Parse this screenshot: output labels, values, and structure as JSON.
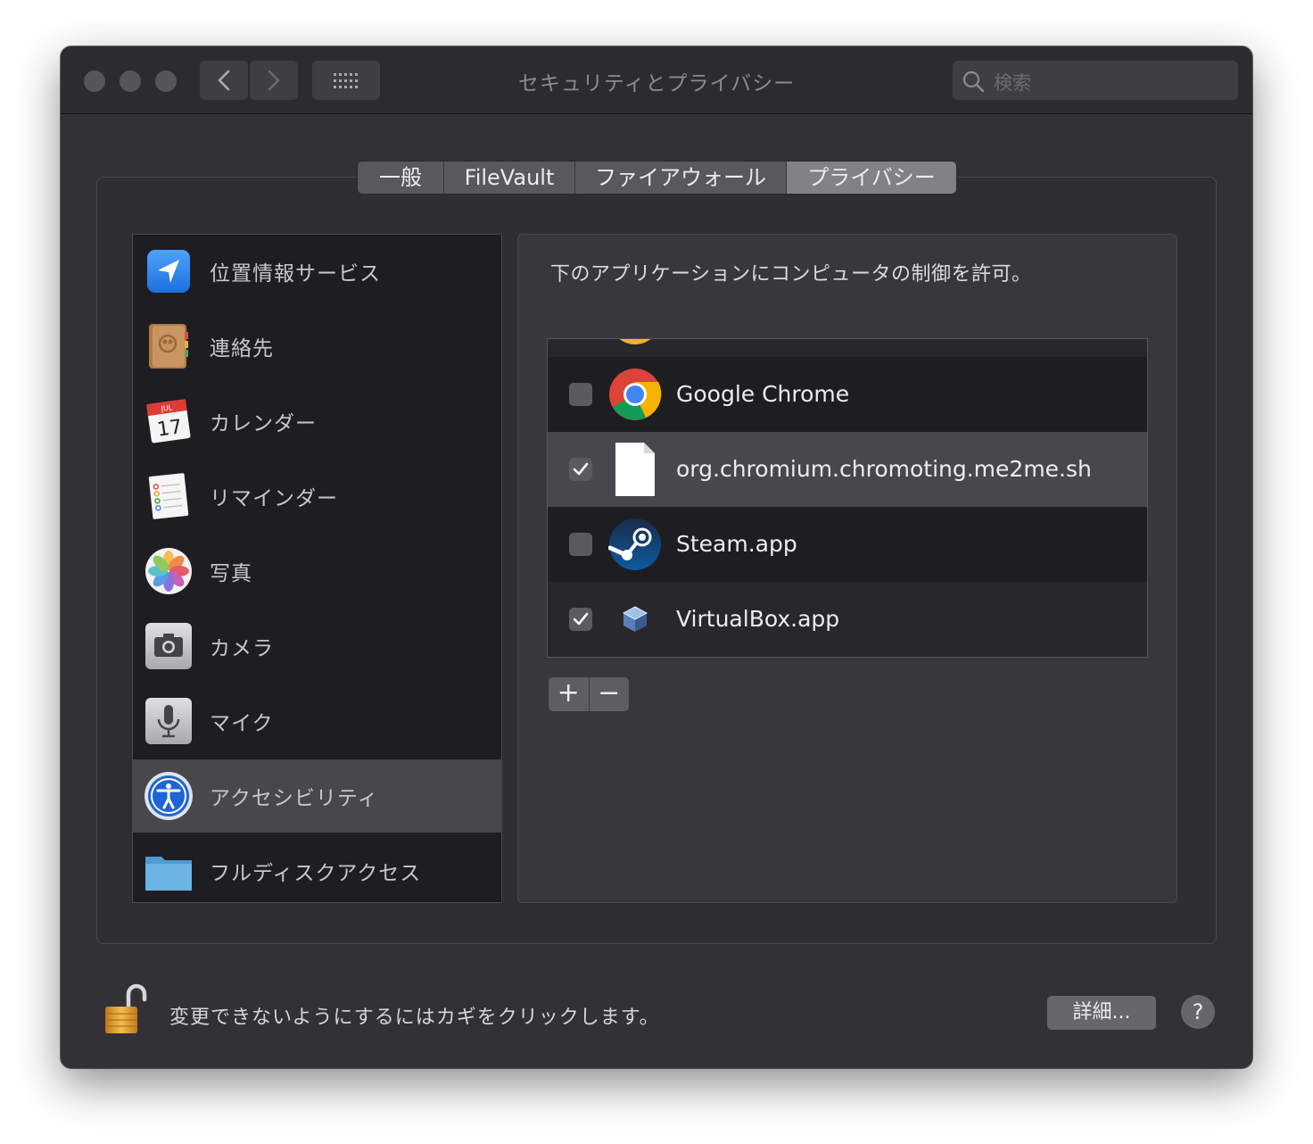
{
  "window": {
    "title": "セキュリティとプライバシー",
    "search_placeholder": "検索"
  },
  "tabs": [
    {
      "label": "一般",
      "active": false
    },
    {
      "label": "FileVault",
      "active": false
    },
    {
      "label": "ファイアウォール",
      "active": false
    },
    {
      "label": "プライバシー",
      "active": true
    }
  ],
  "sidebar": {
    "items": [
      {
        "label": "位置情報サービス",
        "icon": "location-icon"
      },
      {
        "label": "連絡先",
        "icon": "contacts-icon"
      },
      {
        "label": "カレンダー",
        "icon": "calendar-icon"
      },
      {
        "label": "リマインダー",
        "icon": "reminders-icon"
      },
      {
        "label": "写真",
        "icon": "photos-icon"
      },
      {
        "label": "カメラ",
        "icon": "camera-icon"
      },
      {
        "label": "マイク",
        "icon": "microphone-icon"
      },
      {
        "label": "アクセシビリティ",
        "icon": "accessibility-icon",
        "selected": true
      },
      {
        "label": "フルディスクアクセス",
        "icon": "folder-icon"
      }
    ],
    "calendar_month": "JUL",
    "calendar_day": "17"
  },
  "panel": {
    "instruction": "下のアプリケーションにコンピュータの制御を許可。",
    "apps": [
      {
        "name": "Google Chrome",
        "checked": false,
        "icon": "chrome-icon"
      },
      {
        "name": "org.chromium.chromoting.me2me.sh",
        "checked": true,
        "icon": "document-icon",
        "selected": true
      },
      {
        "name": "Steam.app",
        "checked": false,
        "icon": "steam-icon"
      },
      {
        "name": "VirtualBox.app",
        "checked": true,
        "icon": "virtualbox-icon"
      }
    ],
    "add_label": "+",
    "remove_label": "−"
  },
  "footer": {
    "lock_text": "変更できないようにするにはカギをクリックします。",
    "detail_label": "詳細...",
    "help_label": "?"
  },
  "colors": {
    "window_bg": "#323236",
    "list_bg": "#1e1e22",
    "selection": "#48484c",
    "accent_blue": "#2b7fe0"
  }
}
